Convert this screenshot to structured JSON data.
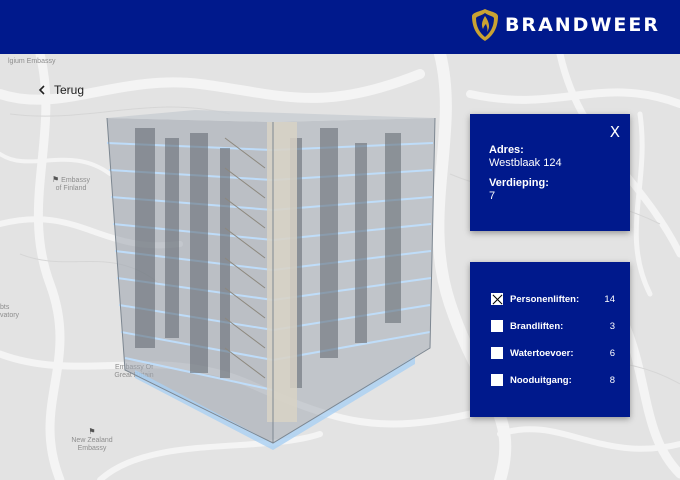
{
  "header": {
    "brand": "BRANDWEER"
  },
  "nav": {
    "back_label": "Terug"
  },
  "map": {
    "labels": [
      "lgium Embassy",
      "Embassy",
      "of Finland",
      "Embassy Of",
      "Great Britain",
      "New Zealand",
      "Embassy",
      "bts",
      "vatory"
    ]
  },
  "info_panel": {
    "close_label": "X",
    "address_label": "Adres:",
    "address_value": "Westblaak 124",
    "floor_label": "Verdieping:",
    "floor_value": "7"
  },
  "filters": [
    {
      "label": "Personenliften:",
      "count": "14",
      "checked": true
    },
    {
      "label": "Brandliften:",
      "count": "3",
      "checked": false
    },
    {
      "label": "Watertoevoer:",
      "count": "6",
      "checked": false
    },
    {
      "label": "Nooduitgang:",
      "count": "8",
      "checked": false
    }
  ],
  "colors": {
    "brand_blue": "#00198c",
    "accent_gold": "#c9a233",
    "map_bg": "#e3e3e3"
  }
}
